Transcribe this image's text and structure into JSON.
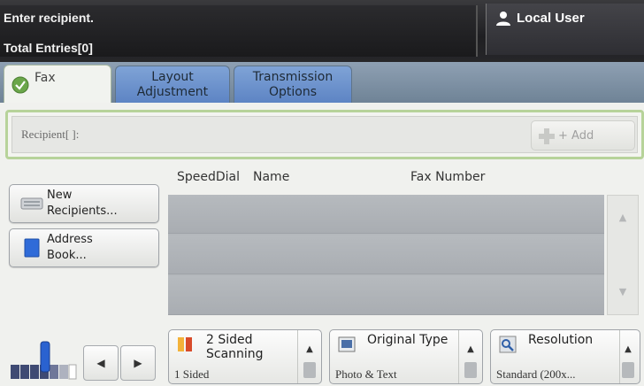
{
  "status": {
    "message": "Enter recipient.",
    "total_entries": "Total Entries[0]"
  },
  "user": {
    "label": "Local User"
  },
  "tabs": [
    {
      "label": "Fax",
      "active": true
    },
    {
      "label": "Layout Adjustment",
      "active": false
    },
    {
      "label": "Transmission Options",
      "active": false
    }
  ],
  "recipient": {
    "label": "Recipient[   ]:",
    "add_label": "+ Add"
  },
  "list": {
    "columns": [
      "SpeedDial",
      "Name",
      "Fax Number"
    ],
    "rows": [
      {
        "speed_dial": "",
        "name": "",
        "fax_number": ""
      },
      {
        "speed_dial": "",
        "name": "",
        "fax_number": ""
      },
      {
        "speed_dial": "",
        "name": "",
        "fax_number": ""
      }
    ]
  },
  "side_buttons": {
    "new_recipients": "New\nRecipients...",
    "address_book": "Address\nBook..."
  },
  "features": {
    "two_sided": {
      "title": "2 Sided\nScanning",
      "value": "1 Sided"
    },
    "original_type": {
      "title": "Original Type",
      "value": "Photo & Text"
    },
    "resolution": {
      "title": "Resolution",
      "value": "Standard (200x..."
    }
  },
  "colors": {
    "accent_green": "#b7d39a",
    "tab_blue": "#6f8fcf",
    "address_book_blue": "#2f6bd8"
  }
}
